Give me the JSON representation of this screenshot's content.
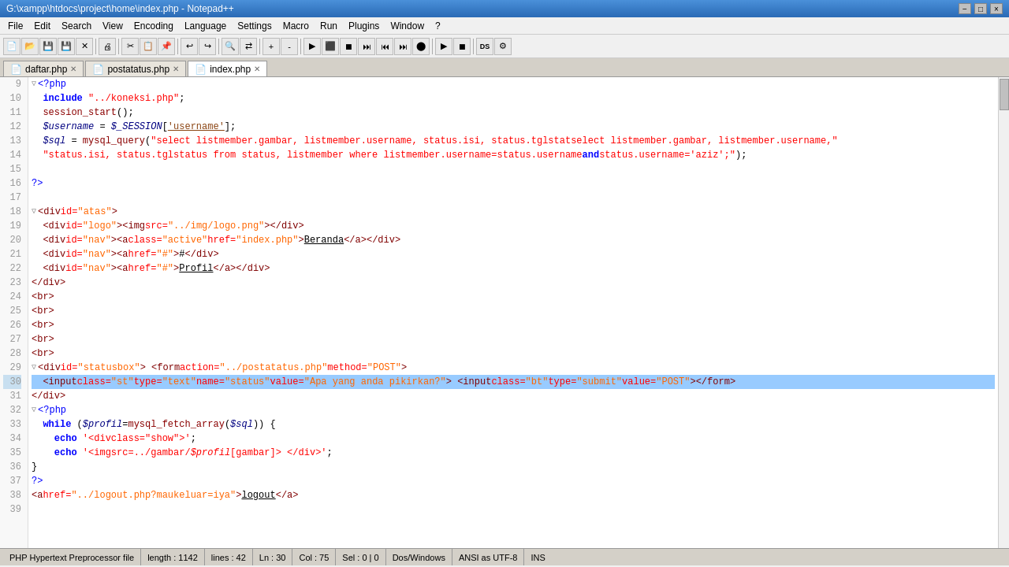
{
  "window": {
    "title": "G:\\xampp\\htdocs\\project\\home\\index.php - Notepad++",
    "minimize": "−",
    "maximize": "□",
    "close": "×"
  },
  "menu": {
    "items": [
      "File",
      "Edit",
      "Search",
      "View",
      "Encoding",
      "Language",
      "Settings",
      "Macro",
      "Run",
      "Plugins",
      "Window",
      "?"
    ]
  },
  "tabs": [
    {
      "name": "daftar.php",
      "active": false,
      "icon": "📄"
    },
    {
      "name": "postatatus.php",
      "active": false,
      "icon": "📄"
    },
    {
      "name": "index.php",
      "active": true,
      "icon": "📄"
    }
  ],
  "status": {
    "file_type": "PHP Hypertext Preprocessor file",
    "length": "length : 1142",
    "lines": "lines : 42",
    "ln": "Ln : 30",
    "col": "Col : 75",
    "sel": "Sel : 0 | 0",
    "eol": "Dos/Windows",
    "encoding": "ANSI as UTF-8",
    "ins": "INS"
  },
  "code_lines": [
    {
      "num": 9,
      "content": "<?php",
      "type": "php"
    },
    {
      "num": 10,
      "content": "include \"../koneksi.php\";",
      "type": "php"
    },
    {
      "num": 11,
      "content": "session_start();",
      "type": "php"
    },
    {
      "num": 12,
      "content": "$username = $_SESSION['username'];",
      "type": "php"
    },
    {
      "num": 13,
      "content": "$sql = mysql_query(\"select listmember.gambar, listmember.username, status.isi, status.tglstatselect listmember.gambar, listmember.username,",
      "type": "php"
    },
    {
      "num": 14,
      "content": "status.isi, status.tglstatus from status, listmember where listmember.username=status.username and status.username='aziz';\");",
      "type": "php"
    },
    {
      "num": 15,
      "content": "",
      "type": "empty"
    },
    {
      "num": 16,
      "content": "?>",
      "type": "php"
    },
    {
      "num": 17,
      "content": "",
      "type": "empty"
    },
    {
      "num": 18,
      "content": "<div id=\"atas\">",
      "type": "html"
    },
    {
      "num": 19,
      "content": "  <div id=\"logo\"><img src=\"../img/logo.png\"></div>",
      "type": "html"
    },
    {
      "num": 20,
      "content": "  <div id=\"nav\" ><a class=\"active\" href=\"index.php\" >Beranda</a></div>",
      "type": "html"
    },
    {
      "num": 21,
      "content": "  <div id=\"nav\"><a href=\"#\">#</div>",
      "type": "html"
    },
    {
      "num": 22,
      "content": "  <div id=\"nav\"><a href=\"#\">Profil</a></div>",
      "type": "html"
    },
    {
      "num": 23,
      "content": "</div>",
      "type": "html"
    },
    {
      "num": 24,
      "content": "<br>",
      "type": "html"
    },
    {
      "num": 25,
      "content": "<br>",
      "type": "html"
    },
    {
      "num": 26,
      "content": "<br>",
      "type": "html"
    },
    {
      "num": 27,
      "content": "<br>",
      "type": "html"
    },
    {
      "num": 28,
      "content": "<br>",
      "type": "html"
    },
    {
      "num": 29,
      "content": "<div id=\"statusbox\"> <form action=\"../postatatus.php\" method=\"POST\">",
      "type": "html"
    },
    {
      "num": 30,
      "content": "  <input class=\"st\" type=\"text\" name=\"status\" value=\"Apa yang anda pikirkan?\"> <input class=\"bt\" type=\"submit\" value=\"POST\"></form>",
      "type": "html",
      "highlighted": true
    },
    {
      "num": 31,
      "content": "</div>",
      "type": "html"
    },
    {
      "num": 32,
      "content": "<?php",
      "type": "php"
    },
    {
      "num": 33,
      "content": "while ($profil=mysql_fetch_array($sql)) {",
      "type": "php"
    },
    {
      "num": 34,
      "content": "  echo '<div class=\"show\">';",
      "type": "php"
    },
    {
      "num": 35,
      "content": "  echo '<img src=../gambar/$profil[gambar]> </div>';",
      "type": "php"
    },
    {
      "num": 36,
      "content": "}",
      "type": "php"
    },
    {
      "num": 37,
      "content": "?>",
      "type": "php"
    },
    {
      "num": 38,
      "content": "<a href=\"../logout.php?maukeluar=iya\">logout</a>",
      "type": "html"
    },
    {
      "num": 39,
      "content": "",
      "type": "empty"
    }
  ]
}
